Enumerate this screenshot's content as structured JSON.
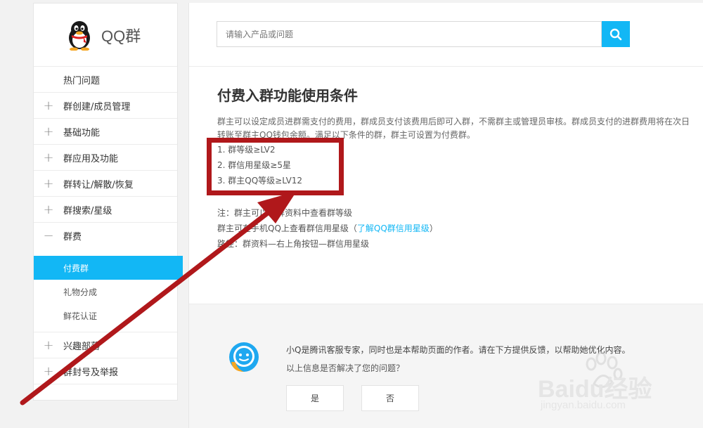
{
  "sidebar": {
    "logo_text": "QQ群",
    "items": [
      {
        "label": "热门问题",
        "symbol": ""
      },
      {
        "label": "群创建/成员管理",
        "symbol": "+"
      },
      {
        "label": "基础功能",
        "symbol": "+"
      },
      {
        "label": "群应用及功能",
        "symbol": "+"
      },
      {
        "label": "群转让/解散/恢复",
        "symbol": "+"
      },
      {
        "label": "群搜索/星级",
        "symbol": "+"
      },
      {
        "label": "群费",
        "symbol": "−"
      }
    ],
    "subitems": [
      {
        "label": "付费群"
      },
      {
        "label": "礼物分成"
      },
      {
        "label": "鲜花认证"
      }
    ],
    "items_after": [
      {
        "label": "兴趣部落",
        "symbol": "+"
      },
      {
        "label": "群封号及举报",
        "symbol": "+"
      }
    ]
  },
  "search": {
    "placeholder": "请输入产品或问题"
  },
  "article": {
    "title": "付费入群功能使用条件",
    "paragraph": "群主可以设定成员进群需支付的费用，群成员支付该费用后即可入群，不需群主或管理员审核。群成员支付的进群费用将在次日转账至群主QQ钱包余额。满足以下条件的群，群主可设置为付费群。",
    "conditions": [
      "1. 群等级≥LV2",
      "2. 群信用星级≥5星",
      "3. 群主QQ等级≥LV12"
    ],
    "note1": "注：群主可以在群资料中查看群等级",
    "note2_prefix": "群主可在手机QQ上查看群信用星级（",
    "note2_link": "了解QQ群信用星级",
    "note2_suffix": "）",
    "note3": "路径：群资料—右上角按钮—群信用星级"
  },
  "feedback": {
    "intro": "小Q是腾讯客服专家，同时也是本帮助页面的作者。请在下方提供反馈，以帮助她优化内容。",
    "question": "以上信息是否解决了您的问题？",
    "yes_label": "是",
    "no_label": "否"
  },
  "watermark": {
    "brand": "Baidu经验",
    "url": "jingyan.baidu.com"
  },
  "colors": {
    "accent": "#12b7f5",
    "annotation": "#b0181b"
  },
  "icons": [
    "qq-penguin-icon",
    "search-icon",
    "plus-icon",
    "minus-icon",
    "xiaoq-bot-icon",
    "baidu-paw-icon"
  ]
}
